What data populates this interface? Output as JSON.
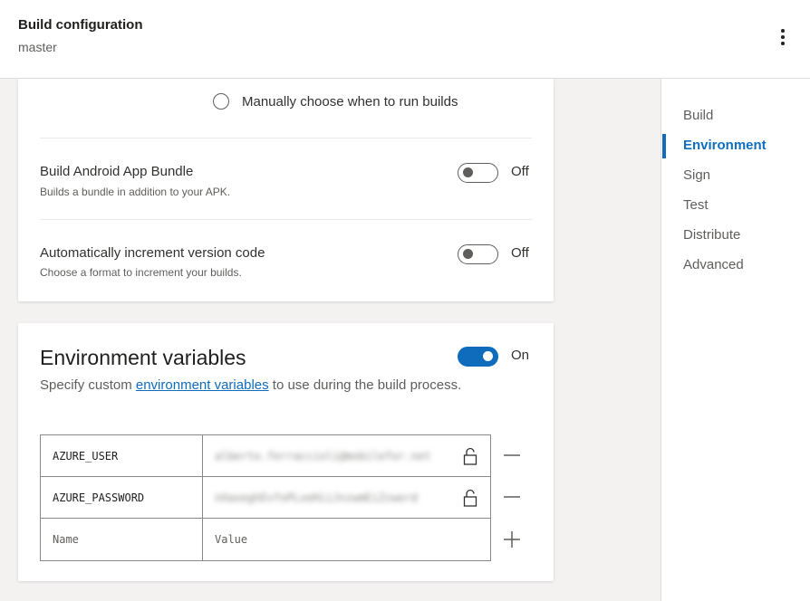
{
  "header": {
    "title": "Build configuration",
    "branch": "master",
    "more_icon": "more-vertical-icon"
  },
  "nav": {
    "items": [
      {
        "label": "Build",
        "active": false
      },
      {
        "label": "Environment",
        "active": true
      },
      {
        "label": "Sign",
        "active": false
      },
      {
        "label": "Test",
        "active": false
      },
      {
        "label": "Distribute",
        "active": false
      },
      {
        "label": "Advanced",
        "active": false
      }
    ]
  },
  "build_card": {
    "radio_label": "Manually choose when to run builds",
    "bundle": {
      "title": "Build Android App Bundle",
      "desc": "Builds a bundle in addition to your APK.",
      "toggle_label": "Off"
    },
    "increment": {
      "title": "Automatically increment version code",
      "desc": "Choose a format to increment your builds.",
      "toggle_label": "Off"
    }
  },
  "env_card": {
    "title": "Environment variables",
    "toggle_label": "On",
    "desc_before": "Specify custom ",
    "desc_link": "environment variables",
    "desc_after": " to use during the build process.",
    "rows": [
      {
        "name": "AZURE_USER",
        "value": "alberto.ferraccioli@mobilefor.net",
        "icon": "lock-icon",
        "action_icon": "minus-icon"
      },
      {
        "name": "AZURE_PASSWORD",
        "value": "nXaxeghEvfoPLxeHiiJnzwmEiZzwerd",
        "icon": "lock-icon",
        "action_icon": "minus-icon"
      }
    ],
    "new_row": {
      "name_placeholder": "Name",
      "value_placeholder": "Value",
      "action_icon": "plus-icon"
    }
  },
  "colors": {
    "accent": "#0f6cbd",
    "nav_active_text": "#106ebe",
    "background": "#f3f2f1"
  }
}
